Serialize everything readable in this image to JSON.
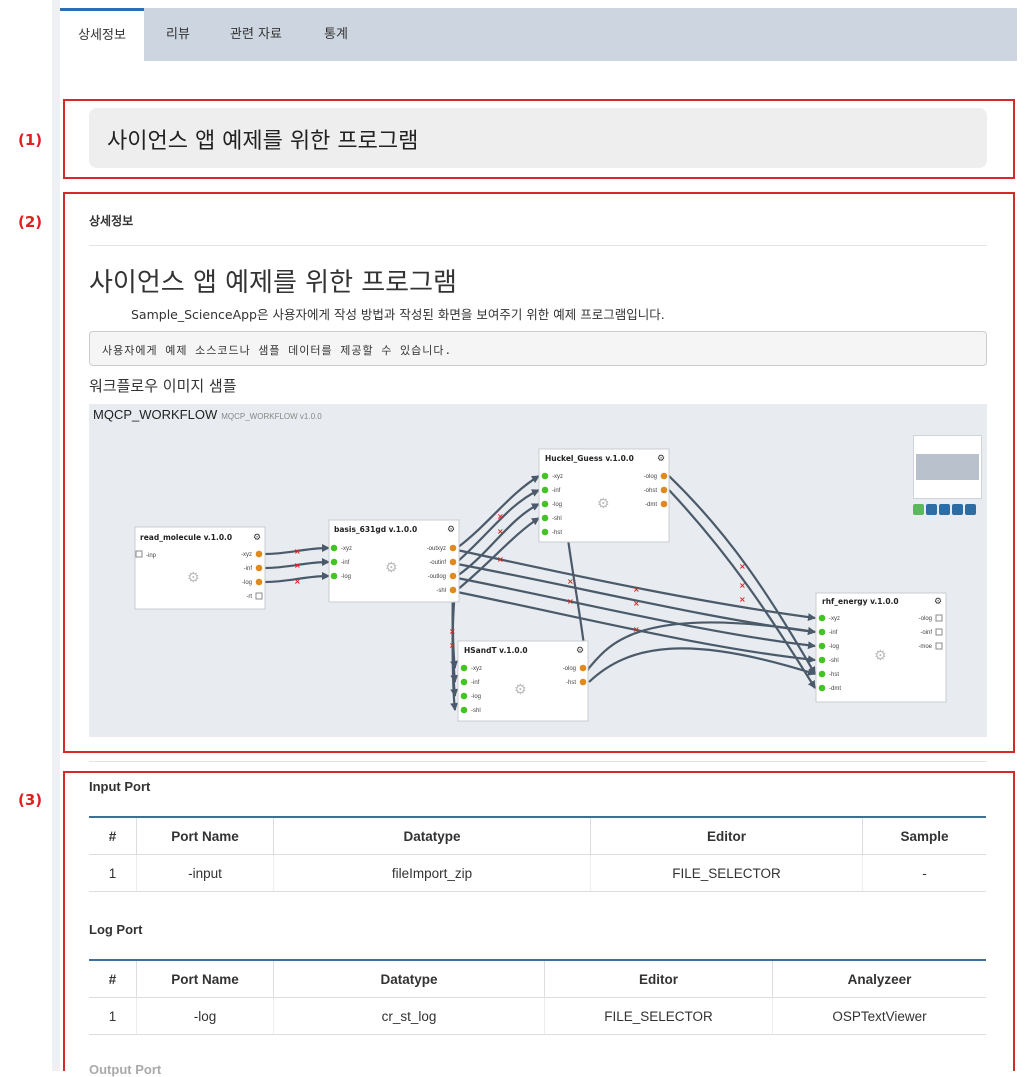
{
  "tabs": [
    {
      "label": "상세정보",
      "active": true
    },
    {
      "label": "리뷰",
      "active": false
    },
    {
      "label": "관련 자료",
      "active": false
    },
    {
      "label": "통계",
      "active": false
    }
  ],
  "region_labels": [
    "(1)",
    "(2)",
    "(3)"
  ],
  "app_title": "사이언스 앱 예제를 위한 프로그램",
  "detail": {
    "section_heading": "상세정보",
    "title": "사이언스 앱 예제를 위한 프로그램",
    "description": "Sample_ScienceApp은 사용자에게 작성 방법과 작성된 화면을 보여주기 위한 예제 프로그램입니다.",
    "code_note": "사용자에게 예제 소스코드나 샘플 데이터를 제공할 수 있습니다.",
    "workflow_heading": "워크플로우 이미지 샘플"
  },
  "workflow": {
    "name": "MQCP_WORKFLOW",
    "version_label": "MQCP_WORKFLOW v1.0.0",
    "nodes": [
      {
        "id": "read_molecule",
        "title": "read_molecule v.1.0.0",
        "inputs": [
          "-inp"
        ],
        "outputs": [
          "-xyz",
          "-inf",
          "-log",
          "-rt"
        ]
      },
      {
        "id": "basis",
        "title": "basis_631gd v.1.0.0",
        "inputs": [
          "-xyz",
          "-inf",
          "-log"
        ],
        "outputs": [
          "-outxyz",
          "-outinf",
          "-outlog",
          "-shl"
        ]
      },
      {
        "id": "huckel",
        "title": "Huckel_Guess v.1.0.0",
        "inputs": [
          "-xyz",
          "-inf",
          "-log",
          "-shl",
          "-hst"
        ],
        "outputs": [
          "-olog",
          "-ohst",
          "-dmt"
        ]
      },
      {
        "id": "hsandt",
        "title": "HSandT v.1.0.0",
        "inputs": [
          "-xyz",
          "-inf",
          "-log",
          "-shl"
        ],
        "outputs": [
          "-olog",
          "-hst"
        ]
      },
      {
        "id": "rhf",
        "title": "rhf_energy v.1.0.0",
        "inputs": [
          "-xyz",
          "-inf",
          "-log",
          "-shl",
          "-hst",
          "-dmt"
        ],
        "outputs": [
          "-olog",
          "-oinf",
          "-moe"
        ]
      }
    ],
    "colors": {
      "input_port": "#44c424",
      "output_port": "#e08a1e",
      "edge": "#4a5a6a",
      "edge_marker": "#e02020"
    }
  },
  "ports": {
    "input": {
      "title": "Input Port",
      "headers": [
        "#",
        "Port Name",
        "Datatype",
        "Editor",
        "Sample"
      ],
      "rows": [
        [
          "1",
          "-input",
          "fileImport_zip",
          "FILE_SELECTOR",
          "-"
        ]
      ]
    },
    "log": {
      "title": "Log Port",
      "headers": [
        "#",
        "Port Name",
        "Datatype",
        "Editor",
        "Analyzeer"
      ],
      "rows": [
        [
          "1",
          "-log",
          "cr_st_log",
          "FILE_SELECTOR",
          "OSPTextViewer"
        ]
      ]
    },
    "output_title": "Output Port"
  }
}
